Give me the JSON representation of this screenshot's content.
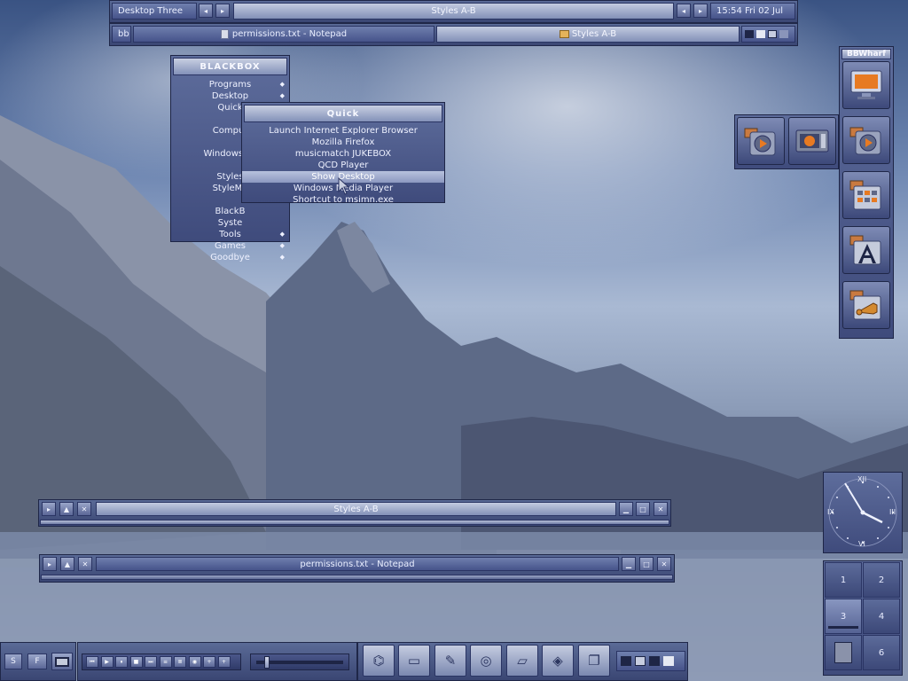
{
  "toolbar": {
    "workspace": "Desktop Three",
    "window_label": "Styles A-B",
    "clock": "15:54 Fri 02 Jul",
    "bb_label": "bb",
    "task1": "permissions.txt - Notepad",
    "task2": "Styles A-B",
    "prev_glyph": "◂",
    "next_glyph": "▸"
  },
  "root_menu": {
    "title": "BLACKBOX",
    "items": [
      {
        "label": "Programs",
        "submenu": true
      },
      {
        "label": "Desktop",
        "submenu": true
      },
      {
        "label": "Quick",
        "submenu": true
      },
      {
        "label": "",
        "submenu": false
      },
      {
        "label": "Comput",
        "submenu": false
      },
      {
        "label": "",
        "submenu": false
      },
      {
        "label": "Windows Ex",
        "submenu": false
      },
      {
        "label": "",
        "submenu": false
      },
      {
        "label": "Styles",
        "submenu": false
      },
      {
        "label": "StyleMa",
        "submenu": false
      },
      {
        "label": "",
        "submenu": false
      },
      {
        "label": "BlackB",
        "submenu": false
      },
      {
        "label": "Syste",
        "submenu": false
      },
      {
        "label": "Tools",
        "submenu": true
      },
      {
        "label": "Games",
        "submenu": true
      },
      {
        "label": "Goodbye",
        "submenu": true
      }
    ]
  },
  "quick_menu": {
    "title": "Quick",
    "items": [
      "Launch Internet Explorer Browser",
      "Mozilla Firefox",
      "musicmatch JUKEBOX",
      "QCD Player",
      "Show Desktop",
      "Windows Media Player",
      "Shortcut to msimn.exe"
    ],
    "highlighted_index": 4
  },
  "bbwharf": {
    "title": "BBWharf",
    "tiles": [
      "monitor-icon",
      "media-player-icon",
      "control-panel-icon",
      "fonts-icon",
      "music-icon"
    ]
  },
  "windows": [
    {
      "title": "Styles A-B"
    },
    {
      "title": "permissions.txt - Notepad"
    }
  ],
  "clock_widget": {
    "numerals": {
      "top": "XII",
      "right": "III",
      "bottom": "VI",
      "left": "IX"
    },
    "time": "15:54"
  },
  "pager": {
    "desktops": [
      "1",
      "2",
      "3",
      "4",
      "",
      "6"
    ],
    "active_index": 2
  },
  "bottom_bar": {
    "left_buttons": [
      "S",
      "F"
    ],
    "media_controls": [
      "⏮",
      "▶",
      "⏸",
      "■",
      "⏭",
      "≡",
      "≣",
      "◉",
      "+",
      "+"
    ],
    "volume_level": 0.12
  },
  "colors": {
    "accent": "#5a6a96",
    "highlight": "#b8c2dd",
    "text": "#e8ecf7"
  }
}
